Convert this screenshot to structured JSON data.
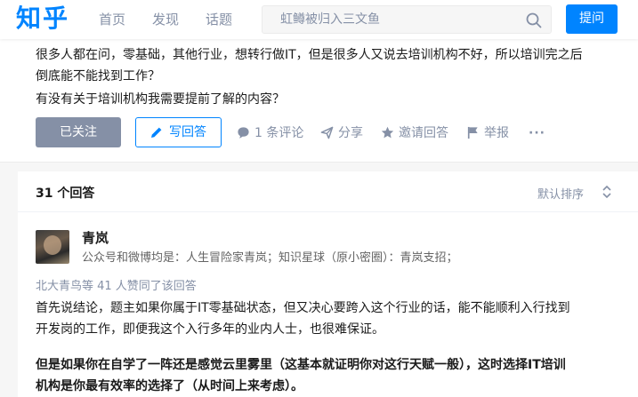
{
  "header": {
    "logo": "知乎",
    "nav": [
      "首页",
      "发现",
      "话题"
    ],
    "search_placeholder": "虹鳟被归入三文鱼",
    "ask_label": "提问"
  },
  "question": {
    "detail_line1": "很多人都在问，零基础，其他行业，想转行做IT，但是很多人又说去培训机构不好，所以培训完之后",
    "detail_line2": "倒底能不能找到工作？",
    "detail_line3": "有没有关于培训机构我需要提前了解的内容？",
    "followed_label": "已关注",
    "write_answer_label": "写回答",
    "comments_label": "1 条评论",
    "share_label": "分享",
    "invite_label": "邀请回答",
    "report_label": "举报",
    "more_label": "···"
  },
  "answers": {
    "count_label": "31 个回答",
    "sort_label": "默认排序",
    "first": {
      "author_name": "青岚",
      "author_bio": "公众号和微博均是：人生冒险家青岚；知识星球（原小密圈）：青岚支招；",
      "upvote_info": "北大青鸟等 41 人赞同了该回答",
      "para1_line1": "首先说结论，题主如果你属于IT零基础状态，但又决心要跨入这个行业的话，能不能顺利入行找到",
      "para1_line2": "开发岗的工作，即便我这个入行多年的业内人士，也很难保证。",
      "para2_line1": "但是如果你在自学了一阵还是感觉云里雾里（这基本就证明你对这行天赋一般），这时选择IT培训",
      "para2_line2": "机构是你最有效率的选择了（从时间上来考虑）。"
    }
  },
  "colors": {
    "brand": "#0084ff",
    "muted": "#8590a6",
    "background": "#f6f6f6"
  },
  "icons": [
    "search-icon",
    "pen-icon",
    "comment-icon",
    "share-icon",
    "star-icon",
    "flag-icon",
    "sort-icon"
  ]
}
